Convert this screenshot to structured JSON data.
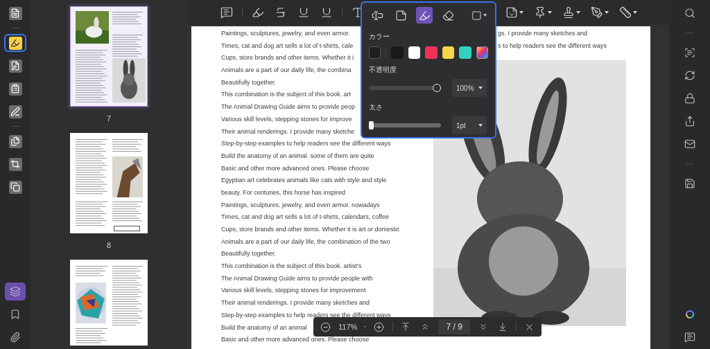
{
  "left_rail": {
    "tools": [
      {
        "kind": "reader",
        "selected": false
      },
      {
        "kind": "comment",
        "selected": true
      },
      {
        "kind": "edit",
        "selected": false
      },
      {
        "kind": "form",
        "selected": false
      },
      {
        "kind": "sign",
        "selected": false
      },
      {
        "kind": "organize",
        "selected": false
      },
      {
        "kind": "crop",
        "selected": false
      },
      {
        "kind": "watermark",
        "selected": false
      }
    ],
    "bottom_tools": [
      {
        "kind": "layers",
        "selected": true
      },
      {
        "kind": "bookmark",
        "selected": false
      },
      {
        "kind": "attachment",
        "selected": false
      }
    ]
  },
  "thumbnails": [
    {
      "label": "7",
      "selected": true
    },
    {
      "label": "8",
      "selected": false
    },
    {
      "selected": false
    }
  ],
  "toolbar": {
    "tools": [
      {
        "kind": "comment"
      },
      {
        "kind": "highlight"
      },
      {
        "kind": "strikethrough"
      },
      {
        "kind": "underline"
      },
      {
        "kind": "squiggly"
      },
      {
        "kind": "text"
      }
    ],
    "more_tools": [
      {
        "kind": "sticker"
      },
      {
        "kind": "pin"
      },
      {
        "kind": "stamp"
      },
      {
        "kind": "signature"
      },
      {
        "kind": "measure"
      }
    ]
  },
  "popup": {
    "tools": [
      {
        "kind": "textbox",
        "selected": false
      },
      {
        "kind": "callout",
        "selected": false
      },
      {
        "kind": "pencil",
        "selected": true
      },
      {
        "kind": "eraser",
        "selected": false
      },
      {
        "kind": "shape",
        "selected": false
      }
    ],
    "color_label": "カラー",
    "colors": [
      {
        "kind": "solid",
        "color": "#1f1f21",
        "selected": true
      },
      {
        "kind": "solid",
        "color": "#19191b",
        "selected": false
      },
      {
        "kind": "solid",
        "color": "#ffffff",
        "selected": false
      },
      {
        "kind": "solid",
        "color": "#f0325a",
        "selected": false
      },
      {
        "kind": "solid",
        "color": "#f7d54a",
        "selected": false
      },
      {
        "kind": "solid",
        "color": "#2fd3bf",
        "selected": false
      },
      {
        "kind": "custom",
        "selected": false
      }
    ],
    "opacity": {
      "label": "不透明度",
      "level": 1,
      "value": "100%"
    },
    "thickness": {
      "label": "太さ",
      "level": 0,
      "value": "1pt"
    }
  },
  "page": {
    "left_column": [
      "Paintings, sculptures, jewelry, and even armor.",
      "Times, cat and dog art sells a lot of t-shirts, cale",
      "Cups, store brands and other items. Whether it i",
      "Animals are a part of our daily life, the combina",
      "Beautifully together.",
      "This combination is the subject of this book. art",
      "The Animal Drawing Guide aims to provide peop",
      "Various skill levels, stepping stones for improve",
      "Their animal renderings. I provide many sketche",
      "Step-by-step examples to help readers see the different ways",
      "Build the anatomy of an animal. some of them are quite",
      "Basic and other more advanced ones. Please choose",
      "Egyptian art celebrates animals like cats with style and style",
      "beauty. For centuries, this horse has inspired",
      "Paintings, sculptures, jewelry, and even armor. nowadays",
      "Times, cat and dog art sells a lot of t-shirts, calendars, coffee",
      "Cups, store brands and other items. Whether it is art or domestic",
      "Animals are a part of our daily life, the combination of the two",
      "Beautifully together.",
      "This combination is the subject of this book. artist's",
      "The Animal Drawing Guide aims to provide people with",
      "Various skill levels, stepping stones for improvement",
      "Their animal renderings. I provide many sketches and",
      "Step-by-step examples to help readers see the different ways",
      "Build the anatomy of an animal",
      "Basic and other more advanced ones. Please choose"
    ],
    "right_column": [
      "gs. I provide many sketches and",
      "s to help readers see the different ways"
    ],
    "image": {
      "kind": "picture"
    }
  },
  "page_bar": {
    "zoom": "117%",
    "page": "7 / 9"
  },
  "right_rail": {
    "tools": [
      {
        "kind": "search"
      },
      {
        "kind": "ocr"
      },
      {
        "kind": "convert"
      },
      {
        "kind": "protect"
      },
      {
        "kind": "share"
      },
      {
        "kind": "mail"
      },
      {
        "kind": "save"
      }
    ],
    "bottom_tools": [
      {
        "kind": "apps"
      },
      {
        "kind": "feedback"
      }
    ]
  }
}
